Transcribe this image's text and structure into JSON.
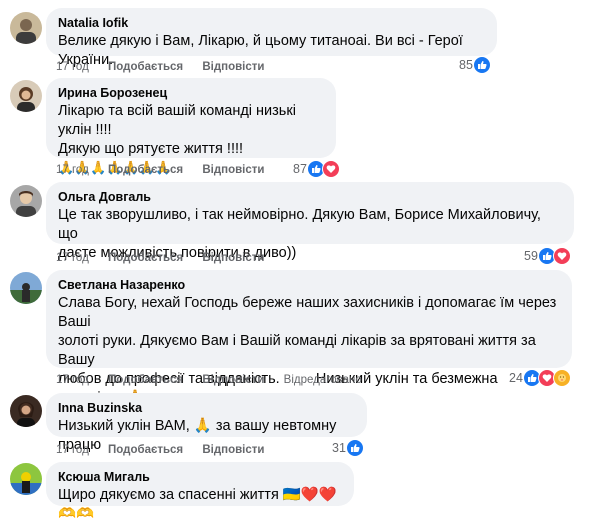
{
  "comments": [
    {
      "author": "Natalia Iofik",
      "text": "Велике дякую і Вам, Лікарю, й цьому титаноаі. Ви всі - Герої України.",
      "emoji": "",
      "time": "17 год",
      "like_label": "Подобається",
      "reply_label": "Відповісти",
      "edited_label": "",
      "reaction_count": "85",
      "reactions": [
        "like"
      ]
    },
    {
      "author": "Ирина Борозенец",
      "text": "Лікарю та всій вашій команді низькі уклін !!!!\nДякую що рятуєте життя !!!!",
      "emoji": "🙏🙏🙏🙏🙏🙏🙏",
      "time": "17 год",
      "like_label": "Подобається",
      "reply_label": "Відповісти",
      "edited_label": "",
      "reaction_count": "87",
      "reactions": [
        "like",
        "love"
      ]
    },
    {
      "author": "Ольга Довгаль",
      "text": "Це так зворушливо, і так неймовірно. Дякую Вам, Борисе Михайловичу, що\nдаєте можливість повірити в диво))",
      "emoji": "",
      "time": "17 год",
      "like_label": "Подобається",
      "reply_label": "Відповісти",
      "edited_label": "",
      "reaction_count": "59",
      "reactions": [
        "like",
        "love"
      ]
    },
    {
      "author": "Светлана Назаренко",
      "text": "Слава Богу, нехай Господь береже наших захисників і допомагає їм через Ваші\nзолоті руки. Дякуємо Вам і Вашій команді лікарів за врятовані життя за Вашу\nлюбов до професії та відданість.         Низький уклін та безмежна вдячність 🙏",
      "emoji": "🙏🙏🙏🙏🙏🙏🙏",
      "time": "17 год",
      "like_label": "Подобається",
      "reply_label": "Відповісти",
      "edited_label": "Відредаговано",
      "reaction_count": "24",
      "reactions": [
        "like",
        "love",
        "care"
      ]
    },
    {
      "author": "Inna Buzinska",
      "text": "Низький уклін ВАМ, 🙏 за вашу невтомну працю",
      "emoji": "",
      "time": "17 год",
      "like_label": "Подобається",
      "reply_label": "Відповісти",
      "edited_label": "",
      "reaction_count": "31",
      "reactions": [
        "like"
      ]
    },
    {
      "author": "Ксюша Мигаль",
      "text": "Щиро дякуємо за спасенні життя 🇺🇦❤️❤️🫶🫶",
      "emoji": "",
      "time": "",
      "like_label": "",
      "reply_label": "",
      "edited_label": "",
      "reaction_count": "",
      "reactions": []
    }
  ],
  "colors": {
    "bubble": "#f0f2f5",
    "secondary_text": "#65676b",
    "like": "#1877f2",
    "love": "#f33e58",
    "care": "#f7b125"
  }
}
